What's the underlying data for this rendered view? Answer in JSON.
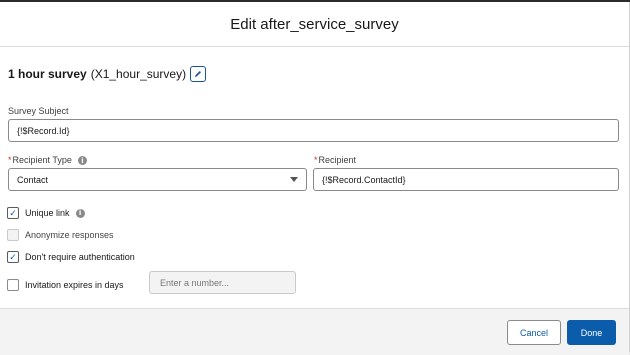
{
  "modal": {
    "title": "Edit after_service_survey"
  },
  "survey": {
    "name": "1 hour survey",
    "api_name": "(X1_hour_survey)"
  },
  "fields": {
    "subject": {
      "label": "Survey Subject",
      "value": "{!$Record.Id}"
    },
    "recipient_type": {
      "required_mark": "*",
      "label": "Recipient Type",
      "value": "Contact"
    },
    "recipient": {
      "required_mark": "*",
      "label": "Recipient",
      "value": "{!$Record.ContactId}"
    }
  },
  "options": {
    "unique_link": {
      "label": "Unique link",
      "checked": true
    },
    "anonymize": {
      "label": "Anonymize responses",
      "checked": false,
      "disabled": true
    },
    "no_auth": {
      "label": "Don't require authentication",
      "checked": true
    },
    "expires": {
      "label": "Invitation expires in days",
      "checked": false,
      "placeholder": "Enter a number..."
    }
  },
  "footer": {
    "cancel_label": "Cancel",
    "done_label": "Done"
  },
  "icons": {
    "info": "info-icon",
    "edit": "pencil-icon",
    "check": "check-icon",
    "dropdown": "chevron-down-icon"
  },
  "colors": {
    "brand": "#0b5cab",
    "required": "#c23934"
  }
}
